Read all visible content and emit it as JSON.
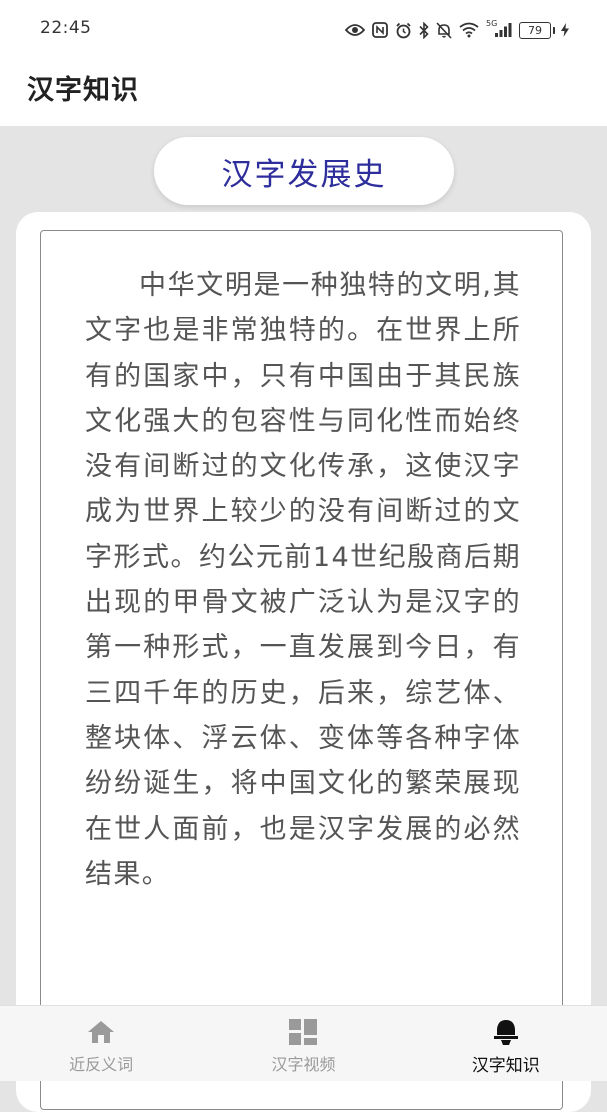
{
  "status_bar": {
    "time": "22:45",
    "network_label": "5G",
    "battery_level": "79",
    "icons": [
      "eye-icon",
      "nfc-icon",
      "alarm-icon",
      "bluetooth-icon",
      "mute-icon",
      "wifi-icon",
      "cellular-signal-icon",
      "battery-icon",
      "charging-icon"
    ]
  },
  "header": {
    "title": "汉字知识"
  },
  "section_title": "汉字发展史",
  "article": {
    "text": "中华文明是一种独特的文明,其文字也是非常独特的。在世界上所有的国家中，只有中国由于其民族文化强大的包容性与同化性而始终没有间断过的文化传承，这使汉字成为世界上较少的没有间断过的文字形式。约公元前14世纪殷商后期出现的甲骨文被广泛认为是汉字的第一种形式，一直发展到今日，有三四千年的历史，后来，综艺体、整块体、浮云体、变体等各种字体纷纷诞生，将中国文化的繁荣展现在世人面前，也是汉字发展的必然结果。"
  },
  "bottom_nav": {
    "active_index": 2,
    "items": [
      {
        "label": "近反义词",
        "icon": "home-icon"
      },
      {
        "label": "汉字视频",
        "icon": "grid-icon"
      },
      {
        "label": "汉字知识",
        "icon": "knowledge-icon"
      }
    ]
  },
  "colors": {
    "accent": "#2e2d9c",
    "background": "#e4e4e4",
    "text": "#555555"
  }
}
